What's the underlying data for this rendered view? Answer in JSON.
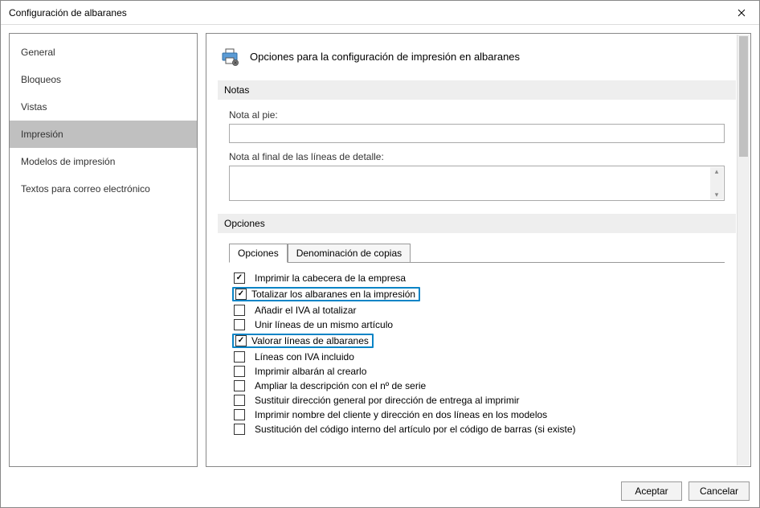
{
  "window": {
    "title": "Configuración de albaranes"
  },
  "sidebar": {
    "items": [
      {
        "label": "General"
      },
      {
        "label": "Bloqueos"
      },
      {
        "label": "Vistas"
      },
      {
        "label": "Impresión",
        "selected": true
      },
      {
        "label": "Modelos de impresión"
      },
      {
        "label": "Textos para correo electrónico"
      }
    ]
  },
  "main": {
    "header_text": "Opciones para la configuración de impresión en albaranes",
    "sections": {
      "notas": {
        "title": "Notas",
        "nota_pie_label": "Nota al pie:",
        "nota_pie_value": "",
        "nota_final_label": "Nota al final de las líneas de detalle:",
        "nota_final_value": ""
      },
      "opciones": {
        "title": "Opciones",
        "tabs": [
          {
            "label": "Opciones",
            "active": true
          },
          {
            "label": "Denominación de copias",
            "active": false
          }
        ],
        "checks": [
          {
            "label": "Imprimir la cabecera de la empresa",
            "checked": true,
            "hl": false
          },
          {
            "label": "Totalizar los albaranes en la impresión",
            "checked": true,
            "hl": true
          },
          {
            "label": "Añadir el IVA al totalizar",
            "checked": false,
            "hl": false
          },
          {
            "label": "Unir líneas de un mismo artículo",
            "checked": false,
            "hl": false
          },
          {
            "label": "Valorar líneas de albaranes",
            "checked": true,
            "hl": true
          },
          {
            "label": "Líneas con IVA incluido",
            "checked": false,
            "hl": false
          },
          {
            "label": "Imprimir albarán al crearlo",
            "checked": false,
            "hl": false
          },
          {
            "label": "Ampliar la descripción con el nº de serie",
            "checked": false,
            "hl": false
          },
          {
            "label": "Sustituir dirección general por dirección de entrega al imprimir",
            "checked": false,
            "hl": false
          },
          {
            "label": "Imprimir nombre del cliente y dirección en dos líneas en los modelos",
            "checked": false,
            "hl": false
          },
          {
            "label": "Sustitución del código interno del artículo por el código de barras (si existe)",
            "checked": false,
            "hl": false
          }
        ]
      }
    }
  },
  "footer": {
    "accept": "Aceptar",
    "cancel": "Cancelar"
  }
}
